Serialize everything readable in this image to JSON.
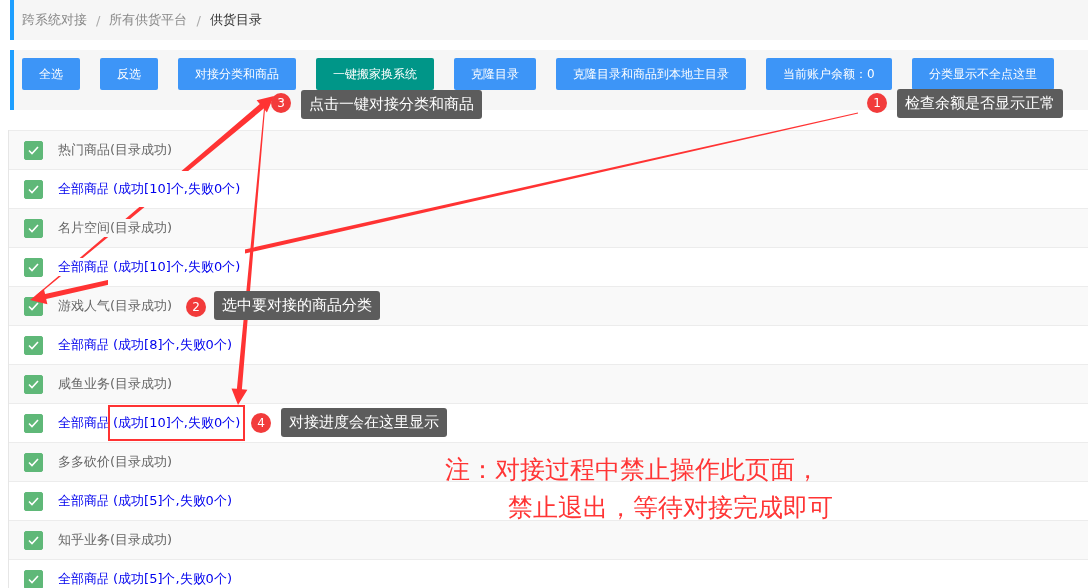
{
  "breadcrumb": [
    {
      "label": "跨系统对接",
      "current": false
    },
    {
      "label": "所有供货平台",
      "current": false
    },
    {
      "label": "供货目录",
      "current": true
    }
  ],
  "breadcrumb_separator": "/",
  "toolbar": [
    {
      "label": "全选",
      "kind": "primary"
    },
    {
      "label": "反选",
      "kind": "primary"
    },
    {
      "label": "对接分类和商品",
      "kind": "primary"
    },
    {
      "label": "一键搬家换系统",
      "kind": "teal"
    },
    {
      "label": "克隆目录",
      "kind": "primary"
    },
    {
      "label": "克隆目录和商品到本地主目录",
      "kind": "primary"
    },
    {
      "label": "当前账户余额：0",
      "kind": "primary"
    },
    {
      "label": "分类显示不全点这里",
      "kind": "primary"
    }
  ],
  "rows": [
    {
      "kind": "category",
      "label": "热门商品(目录成功)",
      "checked": true
    },
    {
      "kind": "product",
      "label": "全部商品",
      "status": "(成功[10]个,失败0个)",
      "checked": true,
      "highlighted": false
    },
    {
      "kind": "category",
      "label": "名片空间(目录成功)",
      "checked": true
    },
    {
      "kind": "product",
      "label": "全部商品",
      "status": "(成功[10]个,失败0个)",
      "checked": true,
      "highlighted": false
    },
    {
      "kind": "category",
      "label": "游戏人气(目录成功)",
      "checked": true
    },
    {
      "kind": "product",
      "label": "全部商品",
      "status": "(成功[8]个,失败0个)",
      "checked": true,
      "highlighted": false
    },
    {
      "kind": "category",
      "label": "咸鱼业务(目录成功)",
      "checked": true
    },
    {
      "kind": "product",
      "label": "全部商品",
      "status": "(成功[10]个,失败0个)",
      "checked": true,
      "highlighted": true
    },
    {
      "kind": "category",
      "label": "多多砍价(目录成功)",
      "checked": true
    },
    {
      "kind": "product",
      "label": "全部商品",
      "status": "(成功[5]个,失败0个)",
      "checked": true,
      "highlighted": false
    },
    {
      "kind": "category",
      "label": "知乎业务(目录成功)",
      "checked": true
    },
    {
      "kind": "product",
      "label": "全部商品",
      "status": "(成功[5]个,失败0个)",
      "checked": true,
      "highlighted": false
    }
  ],
  "annotations": [
    {
      "number": "1",
      "text": "检查余额是否显示正常"
    },
    {
      "number": "2",
      "text": "选中要对接的商品分类"
    },
    {
      "number": "3",
      "text": "点击一键对接分类和商品"
    },
    {
      "number": "4",
      "text": "对接进度会在这里显示"
    }
  ],
  "note": [
    "注：对接过程中禁止操作此页面，",
    "禁止退出，等待对接完成即可"
  ]
}
